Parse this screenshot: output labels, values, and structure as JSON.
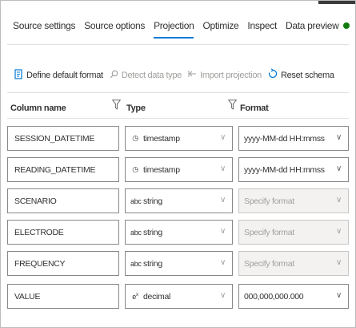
{
  "tabs": [
    {
      "label": "Source settings",
      "active": false
    },
    {
      "label": "Source options",
      "active": false
    },
    {
      "label": "Projection",
      "active": true
    },
    {
      "label": "Optimize",
      "active": false
    },
    {
      "label": "Inspect",
      "active": false
    },
    {
      "label": "Data preview",
      "active": false
    }
  ],
  "colors": {
    "accent": "#0078d4",
    "status_dot": "#107c10"
  },
  "toolbar": {
    "define_default_format": "Define default format",
    "detect_data_type": "Detect data type",
    "import_projection": "Import projection",
    "reset_schema": "Reset schema"
  },
  "columns": {
    "name": "Column name",
    "type": "Type",
    "format": "Format"
  },
  "rows": [
    {
      "name": "SESSION_DATETIME",
      "type": "timestamp",
      "type_icon": "clock-icon",
      "format": "yyyy-MM-dd HH:mmss",
      "format_enabled": true
    },
    {
      "name": "READING_DATETIME",
      "type": "timestamp",
      "type_icon": "clock-icon",
      "format": "yyyy-MM-dd HH:mmss",
      "format_enabled": true
    },
    {
      "name": "SCENARIO",
      "type": "string",
      "type_icon": "abc-icon",
      "format": "Specify format",
      "format_enabled": false
    },
    {
      "name": "ELECTRODE",
      "type": "string",
      "type_icon": "abc-icon",
      "format": "Specify format",
      "format_enabled": false
    },
    {
      "name": "FREQUENCY",
      "type": "string",
      "type_icon": "abc-icon",
      "format": "Specify format",
      "format_enabled": false
    },
    {
      "name": "VALUE",
      "type": "decimal",
      "type_icon": "exponent-icon",
      "format": "000,000,000.000",
      "format_enabled": true
    }
  ]
}
